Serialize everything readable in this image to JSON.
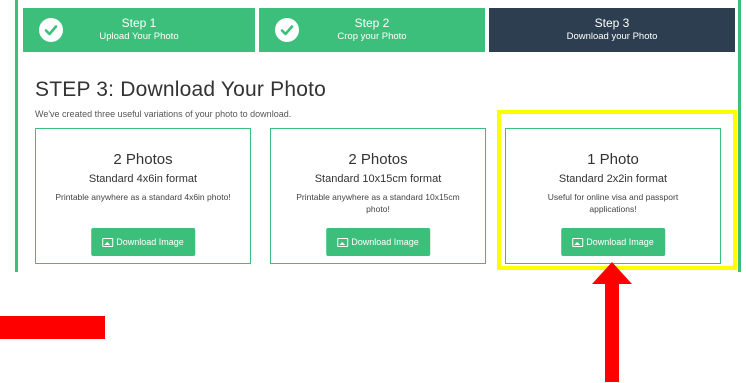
{
  "steps": [
    {
      "number": "Step 1",
      "label": "Upload Your Photo",
      "done": true
    },
    {
      "number": "Step 2",
      "label": "Crop your Photo",
      "done": true
    },
    {
      "number": "Step 3",
      "label": "Download your Photo",
      "done": false
    }
  ],
  "page": {
    "title": "STEP 3: Download Your Photo",
    "subtitle": "We've created three useful variations of your photo to download."
  },
  "cards": [
    {
      "heading": "2 Photos",
      "format": "Standard 4x6in format",
      "description": "Printable anywhere as a standard 4x6in photo!",
      "button": "Download Image"
    },
    {
      "heading": "2 Photos",
      "format": "Standard 10x15cm format",
      "description": "Printable anywhere as a standard 10x15cm photo!",
      "button": "Download Image"
    },
    {
      "heading": "1 Photo",
      "format": "Standard 2x2in format",
      "description": "Useful for online visa and passport applications!",
      "button": "Download Image"
    }
  ],
  "colors": {
    "accent": "#3cbf7a",
    "active_step": "#2c3e50",
    "highlight": "#ffff00",
    "annotation": "#ff0000"
  },
  "icons": {
    "step_done": "check-circle-icon",
    "button": "image-icon"
  }
}
